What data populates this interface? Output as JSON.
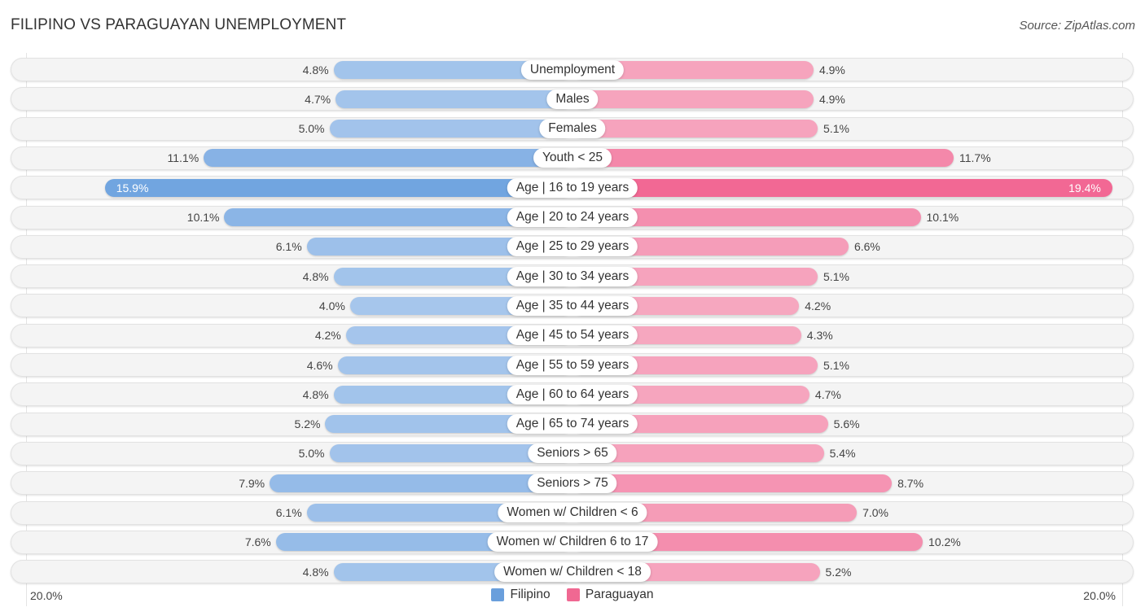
{
  "chart_data": {
    "type": "bar",
    "orientation": "horizontal-diverging",
    "title": "FILIPINO VS PARAGUAYAN UNEMPLOYMENT",
    "source": "Source: ZipAtlas.com",
    "categories": [
      "Unemployment",
      "Males",
      "Females",
      "Youth < 25",
      "Age | 16 to 19 years",
      "Age | 20 to 24 years",
      "Age | 25 to 29 years",
      "Age | 30 to 34 years",
      "Age | 35 to 44 years",
      "Age | 45 to 54 years",
      "Age | 55 to 59 years",
      "Age | 60 to 64 years",
      "Age | 65 to 74 years",
      "Seniors > 65",
      "Seniors > 75",
      "Women w/ Children < 6",
      "Women w/ Children 6 to 17",
      "Women w/ Children < 18"
    ],
    "series": [
      {
        "name": "Filipino",
        "color": "#6a9fdc",
        "values": [
          4.8,
          4.7,
          5.0,
          11.1,
          15.9,
          10.1,
          6.1,
          4.8,
          4.0,
          4.2,
          4.6,
          4.8,
          5.2,
          5.0,
          7.9,
          6.1,
          7.6,
          4.8
        ]
      },
      {
        "name": "Paraguayan",
        "color": "#f06892",
        "values": [
          4.9,
          4.9,
          5.1,
          11.7,
          19.4,
          10.1,
          6.6,
          5.1,
          4.2,
          4.3,
          5.1,
          4.7,
          5.6,
          5.4,
          8.7,
          7.0,
          10.2,
          5.2
        ]
      }
    ],
    "value_suffix": "%",
    "axis_max": 20.0,
    "axis_labels": {
      "left": "20.0%",
      "right": "20.0%"
    },
    "legend_position": "bottom-center",
    "grid": false
  }
}
